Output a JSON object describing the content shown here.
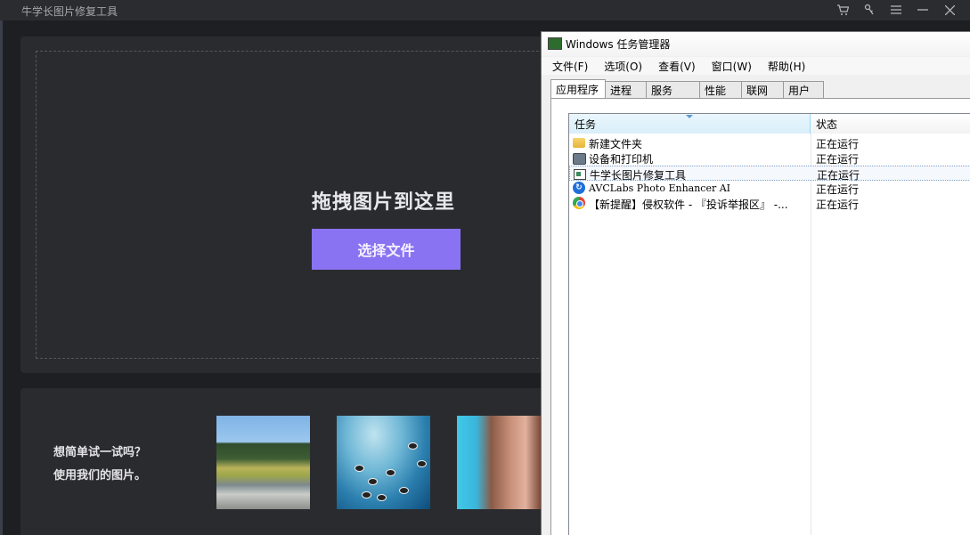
{
  "app": {
    "title": "牛学长图片修复工具",
    "drop_title": "拖拽图片到这里",
    "choose_button": "选择文件",
    "sample_line1": "想简单试一试吗？",
    "sample_line2": "使用我们的图片。",
    "toolbar_icons": [
      "cart-icon",
      "key-icon",
      "menu-icon",
      "minimize-icon",
      "close-icon"
    ],
    "accent_color": "#8a73f2"
  },
  "taskmgr": {
    "title": "Windows 任务管理器",
    "menus": [
      "文件(F)",
      "选项(O)",
      "查看(V)",
      "窗口(W)",
      "帮助(H)"
    ],
    "tabs": [
      "应用程序",
      "进程",
      "服务",
      "性能",
      "联网",
      "用户"
    ],
    "active_tab": "应用程序",
    "columns": {
      "task": "任务",
      "status": "状态"
    },
    "rows": [
      {
        "task": "新建文件夹",
        "status": "正在运行",
        "icon": "folder-icon"
      },
      {
        "task": "设备和打印机",
        "status": "正在运行",
        "icon": "printer-icon"
      },
      {
        "task": "牛学长图片修复工具",
        "status": "正在运行",
        "icon": "app-icon",
        "selected": true
      },
      {
        "task": "AVCLabs Photo Enhancer AI",
        "status": "正在运行",
        "icon": "avclabs-icon"
      },
      {
        "task": "【新提醒】侵权软件 - 『投诉举报区』 -...",
        "status": "正在运行",
        "icon": "chrome-icon"
      }
    ]
  }
}
